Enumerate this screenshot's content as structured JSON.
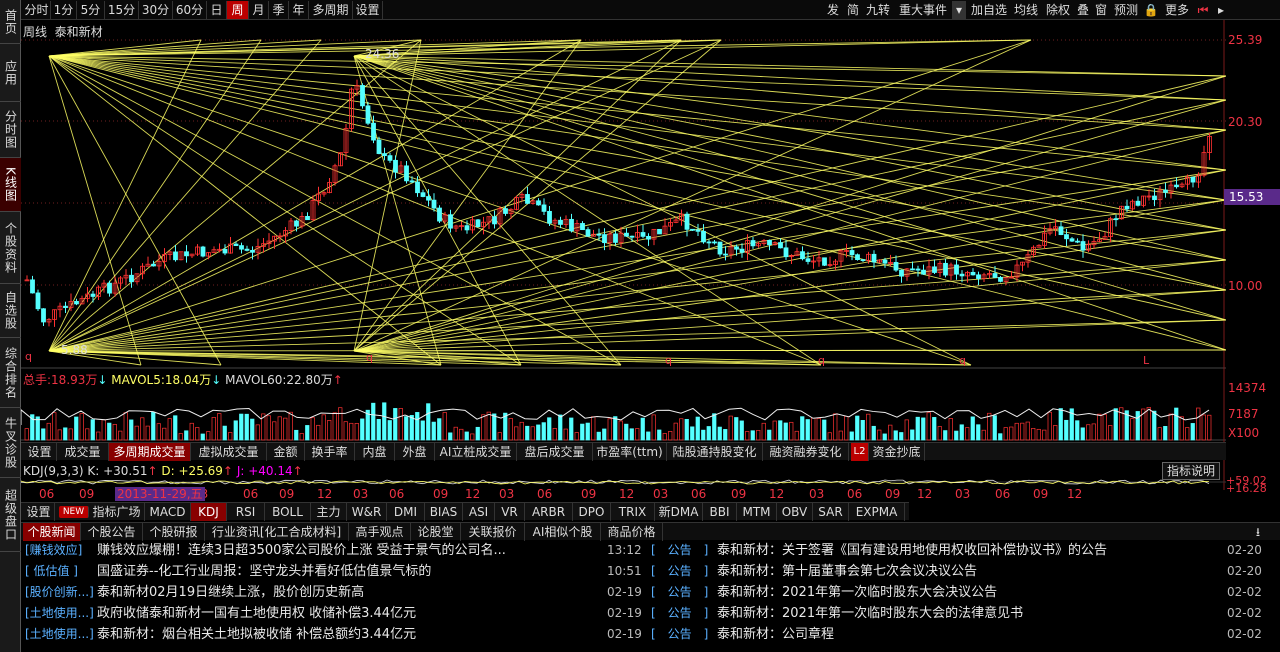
{
  "sidebar": [
    "首页",
    "应用",
    "分时图",
    "K线图",
    "个股资料",
    "自选股",
    "综合排名",
    "牛叉诊股",
    "超级盘口"
  ],
  "periods": [
    "分时",
    "1分",
    "5分",
    "15分",
    "30分",
    "60分",
    "日",
    "周",
    "月",
    "季",
    "年",
    "多周期",
    "设置"
  ],
  "toolbar_right": [
    "发",
    "简",
    "九转",
    "重大事件",
    "▾",
    "加自选",
    "均线",
    "除权",
    "叠",
    "窗",
    "预测",
    "🔒",
    "更多",
    "⏮",
    "▸"
  ],
  "chart": {
    "period": "周线",
    "stock_name": "泰和新材",
    "high_label": "24.36",
    "low_label": "5.88",
    "markers": [
      "q",
      "q",
      "q",
      "q",
      "q",
      "L"
    ]
  },
  "price_axis": [
    "25.39",
    "20.30",
    "15.53",
    "10.00"
  ],
  "current_price": "15.53",
  "volume": {
    "total_label": "总手:",
    "total": "18.93万",
    "ma5_label": "MAVOL5:",
    "ma5": "18.04万",
    "ma60_label": "MAVOL60:",
    "ma60": "22.80万",
    "axis": [
      "14374",
      "7187",
      "X100"
    ]
  },
  "tabs1": [
    "设置",
    "成交量",
    "多周期成交量",
    "虚拟成交量",
    "金额",
    "换手率",
    "内盘",
    "外盘",
    "AI立桩成交量",
    "盘后成交量",
    "市盈率(ttm)",
    "陆股通持股变化",
    "融资融券变化",
    "L2",
    "资金抄底"
  ],
  "kdj": {
    "name": "KDJ(9,3,3)",
    "k": "K: +30.51",
    "d": "D: +25.69",
    "j": "J: +40.14",
    "axis_top": "+59.02",
    "axis_bot": "+16.28",
    "help": "指标说明"
  },
  "date_axis": [
    "06",
    "09",
    "12",
    "03",
    "06",
    "09",
    "12",
    "03",
    "06",
    "09",
    "12",
    "03",
    "06",
    "09",
    "12",
    "03",
    "06",
    "09",
    "12",
    "03",
    "06",
    "09",
    "12",
    "03",
    "06",
    "09",
    "12"
  ],
  "date_cursor": "2013-11-29,五",
  "tabs2": [
    "设置",
    "NEW",
    "指标广场",
    "MACD",
    "KDJ",
    "RSI",
    "BOLL",
    "主力",
    "W&R",
    "DMI",
    "BIAS",
    "ASI",
    "VR",
    "ARBR",
    "DPO",
    "TRIX",
    "新DMA",
    "BBI",
    "MTM",
    "OBV",
    "SAR",
    "EXPMA"
  ],
  "tabs3": [
    "个股新闻",
    "个股公告",
    "个股研报",
    "行业资讯[化工合成材料]",
    "高手观点",
    "论股堂",
    "关联报价",
    "AI相似个股",
    "商品价格"
  ],
  "news_left": [
    {
      "tag": "[赚钱效应]",
      "title": "赚钱效应爆棚！连续3日超3500家公司股价上涨 受益于景气的公司名...",
      "time": "13:12"
    },
    {
      "tag": "[ 低估值 ]",
      "title": "国盛证券--化工行业周报：坚守龙头并看好低估值景气标的",
      "time": "10:51"
    },
    {
      "tag": "[股价创新...]",
      "title": "泰和新材02月19日继续上涨，股价创历史新高",
      "time": "02-19"
    },
    {
      "tag": "[土地使用...]",
      "title": "政府收储泰和新材一国有土地使用权 收储补偿3.44亿元",
      "time": "02-19"
    },
    {
      "tag": "[土地使用...]",
      "title": "泰和新材：烟台相关土地拟被收储 补偿总额约3.44亿元",
      "time": "02-19"
    }
  ],
  "news_right": [
    {
      "tag": "[　公告　]",
      "title": "泰和新材：关于签署《国有建设用地使用权收回补偿协议书》的公告",
      "time": "02-20"
    },
    {
      "tag": "[　公告　]",
      "title": "泰和新材：第十届董事会第七次会议决议公告",
      "time": "02-20"
    },
    {
      "tag": "[　公告　]",
      "title": "泰和新材：2021年第一次临时股东大会决议公告",
      "time": "02-02"
    },
    {
      "tag": "[　公告　]",
      "title": "泰和新材：2021年第一次临时股东大会的法律意见书",
      "time": "02-02"
    },
    {
      "tag": "[　公告　]",
      "title": "泰和新材：公司章程",
      "time": "02-02"
    }
  ],
  "colors": {
    "up": "#ff3232",
    "down": "#54ffff",
    "fan": "#ffff66",
    "axis": "#e34",
    "accent": "#b00"
  }
}
